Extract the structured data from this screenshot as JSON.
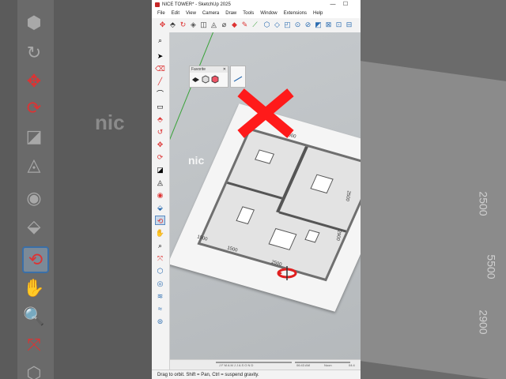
{
  "window": {
    "title": "NICE TOWER* - SketchUp 2025",
    "minimize_glyph": "—",
    "maximize_glyph": "☐"
  },
  "menu": [
    "File",
    "Edit",
    "View",
    "Camera",
    "Draw",
    "Tools",
    "Window",
    "Extensions",
    "Help"
  ],
  "favorites_panel": {
    "title": "Favorite",
    "close_glyph": "✕"
  },
  "plan_dimensions": [
    "4500",
    "2500",
    "2900",
    "1500",
    "1500",
    "2500"
  ],
  "overlay": {
    "brand_text": "nic"
  },
  "timeline": {
    "months": "J F M A M J J A S O N D",
    "time": "06:43 AM",
    "noon": "Noon",
    "end_time": "04:4"
  },
  "status": {
    "text": "Drag to orbit. Shift = Pan, Ctrl = suspend gravity."
  },
  "background": {
    "left_text": "nic",
    "right_dims": [
      "2500",
      "5500",
      "2900"
    ]
  },
  "colors": {
    "accent": "#3a6fa8",
    "red_x": "#ff1a1a",
    "green_axis": "#3aa33a"
  }
}
